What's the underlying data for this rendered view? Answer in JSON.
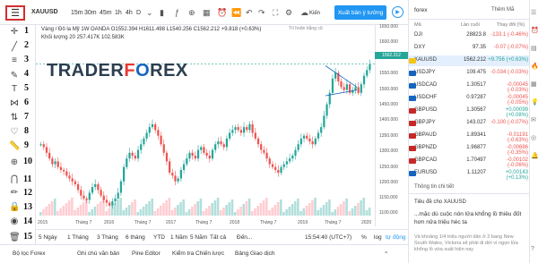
{
  "topbar": {
    "menu_icon": "hamburger-icon",
    "symbol": "XAUUSD",
    "timeframes": [
      "15m",
      "30m",
      "45m",
      "1h",
      "4h",
      "D"
    ],
    "save_label": "Xuất bản ý tưởng",
    "publish_partial": "Kiến"
  },
  "legend": {
    "line1": "Vàng / Đô la Mỹ   1W   OANDA   O1552.394  H1611.498  L1540.256  C1562.212  +9.818 (+0.63%)",
    "line2": "Khối lượng 20   257.417K   102.583K",
    "hint": "Trì hoãn bằng cũ"
  },
  "watermark": {
    "part1": "TRADER",
    "part2": "F",
    "part3": "O",
    "part4": "REX"
  },
  "tools": [
    {
      "num": "1",
      "icon": "crosshair-icon"
    },
    {
      "num": "2",
      "icon": "trend-line-icon"
    },
    {
      "num": "3",
      "icon": "fib-icon"
    },
    {
      "num": "4",
      "icon": "brush-icon"
    },
    {
      "num": "5",
      "icon": "text-icon"
    },
    {
      "num": "6",
      "icon": "pattern-icon"
    },
    {
      "num": "7",
      "icon": "prediction-icon"
    },
    {
      "num": "8",
      "icon": "heart-icon"
    },
    {
      "num": "9",
      "icon": "ruler-icon"
    },
    {
      "num": "10",
      "icon": "zoom-icon"
    },
    {
      "num": "11",
      "icon": "magnet-icon"
    },
    {
      "num": "12",
      "icon": "lock-draw-icon"
    },
    {
      "num": "13",
      "icon": "lock-icon"
    },
    {
      "num": "14",
      "icon": "eye-icon"
    },
    {
      "num": "15",
      "icon": "trash-icon"
    }
  ],
  "yaxis": [
    "1650.000",
    "1600.000",
    "1550.000",
    "1500.000",
    "1450.000",
    "1400.000",
    "1350.000",
    "1300.000",
    "1250.000",
    "1200.000",
    "1150.000",
    "1100.000",
    "1050.000"
  ],
  "price_tag": "1562.212",
  "xaxis": [
    "2015",
    "Tháng 7",
    "2016",
    "Tháng 7",
    "2017",
    "Tháng 7",
    "2018",
    "Tháng 7",
    "2019",
    "Tháng 7",
    "2020"
  ],
  "ranges": [
    "5 Ngày",
    "1 Tháng",
    "3 Tháng",
    "6 tháng",
    "YTD",
    "1 Năm",
    "5 Năm",
    "Tất cả",
    "Đến...",
    "15:54:40 (UTC+7)",
    "%",
    "log",
    "tự động"
  ],
  "bottom_tabs": [
    "Bộ lọc Forex",
    "Ghi chú văn bản",
    "Pine Editor",
    "Kiểm tra Chiến lược",
    "Bảng Giao dịch"
  ],
  "watchlist": {
    "title": "forex",
    "add_label": "Thêm Mã",
    "headers": [
      "Mã",
      "Lần cuối",
      "Thay đổi (%)"
    ],
    "rows": [
      {
        "sym": "DJI",
        "last": "28823.8",
        "chg": "-133.1 (-0.46%)",
        "dir": "down",
        "flag": ""
      },
      {
        "sym": "DXY",
        "last": "97.35",
        "chg": "-0.07 (-0.07%)",
        "dir": "down",
        "flag": ""
      },
      {
        "sym": "XAUUSD",
        "last": "1562.212",
        "chg": "+9.756 (+0.63%)",
        "dir": "up",
        "flag": "#f5c518",
        "selected": true
      },
      {
        "sym": "USDJPY",
        "last": "109.475",
        "chg": "-0.034 (-0.03%)",
        "dir": "down",
        "flag": "#1565c0"
      },
      {
        "sym": "USDCAD",
        "last": "1.30517",
        "chg": "-0.00045 (-0.03%)",
        "dir": "down",
        "flag": "#1565c0"
      },
      {
        "sym": "USDCHF",
        "last": "0.97287",
        "chg": "-0.00045 (-0.05%)",
        "dir": "down",
        "flag": "#1565c0"
      },
      {
        "sym": "GBPUSD",
        "last": "1.30567",
        "chg": "+0.00099 (+0.08%)",
        "dir": "up",
        "flag": "#c62828"
      },
      {
        "sym": "GBPJPY",
        "last": "143.027",
        "chg": "-0.100 (-0.07%)",
        "dir": "down",
        "flag": "#c62828"
      },
      {
        "sym": "GBPAUD",
        "last": "1.89341",
        "chg": "-0.01191 (-0.63%)",
        "dir": "down",
        "flag": "#c62828"
      },
      {
        "sym": "GBPNZD",
        "last": "1.96877",
        "chg": "-0.00686 (-0.35%)",
        "dir": "down",
        "flag": "#c62828"
      },
      {
        "sym": "GBPCAD",
        "last": "1.70497",
        "chg": "-0.00102 (-0.06%)",
        "dir": "down",
        "flag": "#c62828"
      },
      {
        "sym": "EURUSD",
        "last": "1.11207",
        "chg": "+0.00143 (+0.13%)",
        "dir": "up",
        "flag": "#1565c0"
      }
    ],
    "details_title": "Thông tin chi tiết",
    "news_header": "Tiêu đề cho XAUUSD",
    "news_text": "...mặc dù cuộc nón lửa khổng lồ thiêu đốt hơn nửa triệu héc ta",
    "news_sub": "Và khoảng 1/4 triệu người dân ở 2 bang New South Wales, Victoria sẽ phải di dời vì ngọn lửa khổng lồ vừa xuất hiện nay"
  },
  "colors": {
    "up": "#26a69a",
    "down": "#ef5350",
    "accent": "#2196f3",
    "highlight_box": "#d32f2f"
  },
  "chart_data": {
    "type": "candlestick",
    "symbol": "XAUUSD",
    "ylim": [
      1030,
      1660
    ],
    "x_labels": [
      "2015",
      "Tháng 7",
      "2016",
      "Tháng 7",
      "2017",
      "Tháng 7",
      "2018",
      "Tháng 7",
      "2019",
      "Tháng 7",
      "2020"
    ],
    "closes": [
      1280,
      1270,
      1250,
      1230,
      1210,
      1220,
      1200,
      1190,
      1185,
      1170,
      1160,
      1150,
      1140,
      1120,
      1100,
      1090,
      1085,
      1110,
      1130,
      1140,
      1120,
      1100,
      1085,
      1075,
      1065,
      1080,
      1090,
      1110,
      1150,
      1200,
      1230,
      1250,
      1240,
      1230,
      1260,
      1280,
      1300,
      1320,
      1340,
      1350,
      1330,
      1310,
      1280,
      1250,
      1220,
      1180,
      1170,
      1150,
      1160,
      1190,
      1210,
      1230,
      1250,
      1240,
      1230,
      1260,
      1270,
      1250,
      1240,
      1230,
      1260,
      1280,
      1290,
      1280,
      1270,
      1300,
      1320,
      1330,
      1340,
      1330,
      1320,
      1340,
      1330,
      1350,
      1320,
      1300,
      1280,
      1260,
      1250,
      1230,
      1210,
      1200,
      1190,
      1180,
      1200,
      1210,
      1220,
      1230,
      1240,
      1260,
      1280,
      1300,
      1310,
      1300,
      1290,
      1280,
      1300,
      1320,
      1340,
      1380,
      1420,
      1460,
      1510,
      1530,
      1500,
      1480,
      1470,
      1490,
      1460,
      1470,
      1480,
      1460,
      1490,
      1520,
      1540,
      1560
    ]
  }
}
